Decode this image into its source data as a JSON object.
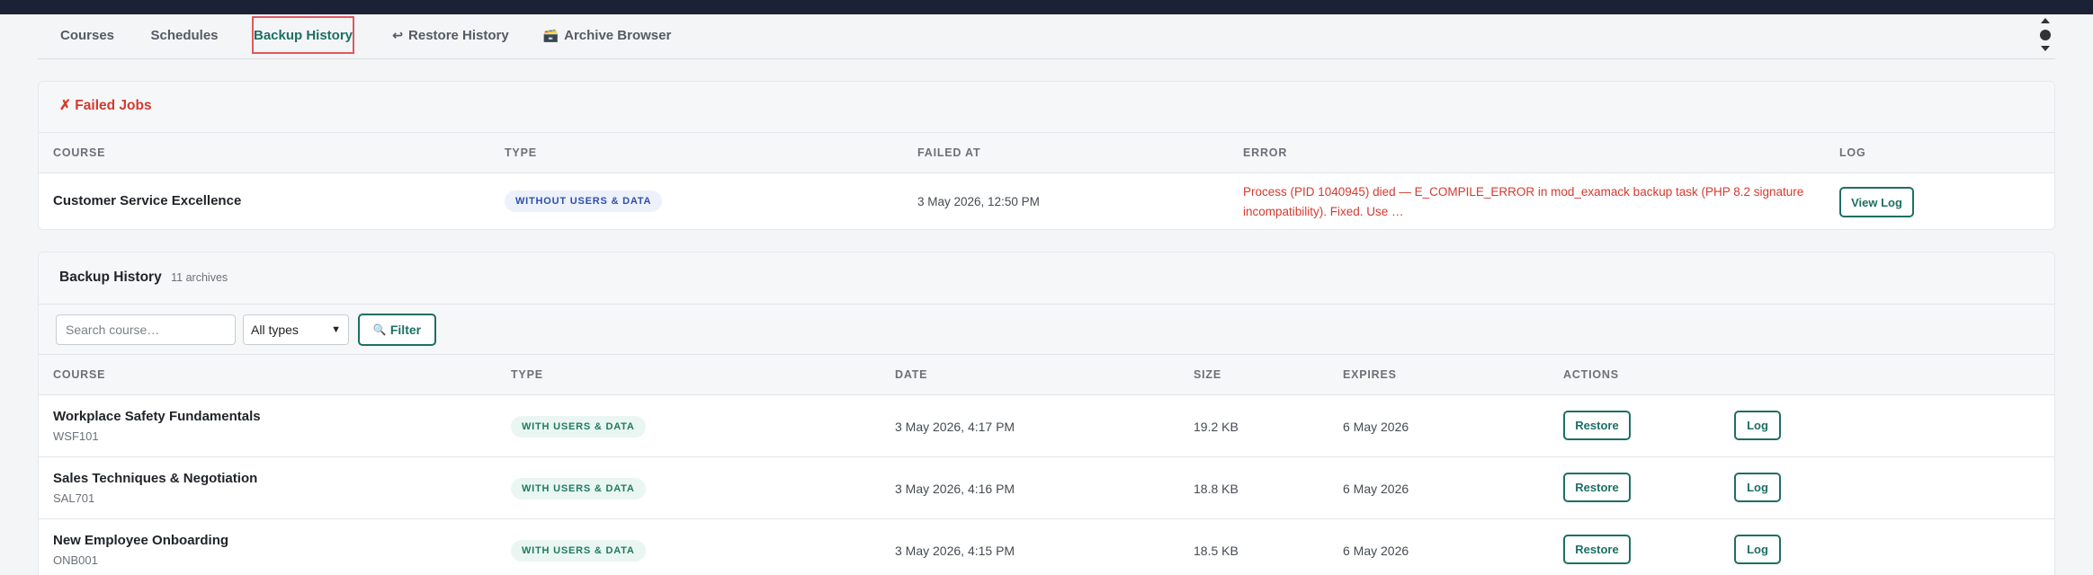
{
  "tabs": [
    {
      "label": "Courses",
      "icon": ""
    },
    {
      "label": "Schedules",
      "icon": ""
    },
    {
      "label": "Backup History",
      "icon": ""
    },
    {
      "label": "Restore History",
      "icon": "↩"
    },
    {
      "label": "Archive Browser",
      "icon": "🗃️"
    }
  ],
  "failed": {
    "title": "✗ Failed Jobs",
    "columns": [
      "Course",
      "Type",
      "Failed At",
      "Error",
      "Log"
    ],
    "rows": [
      {
        "course": "Customer Service Excellence",
        "type": "Without users & data",
        "failed_at": "3 May 2026, 12:50 PM",
        "error": "Process (PID 1040945) died — E_COMPILE_ERROR in mod_examack backup task (PHP 8.2 signature incompatibility). Fixed. Use …",
        "action": "View Log"
      }
    ]
  },
  "history": {
    "title": "Backup History",
    "count": "11 archives",
    "search_placeholder": "Search course…",
    "type_filter": "All types",
    "filter_button": "Filter",
    "filter_icon": "🔍",
    "columns": [
      "Course",
      "Type",
      "Date",
      "Size",
      "Expires",
      "Actions"
    ],
    "restore_label": "Restore",
    "log_label": "Log",
    "rows": [
      {
        "course": "Workplace Safety Fundamentals",
        "code": "WSF101",
        "type": "With users & data",
        "date": "3 May 2026, 4:17 PM",
        "size": "19.2 KB",
        "expires": "6 May 2026"
      },
      {
        "course": "Sales Techniques & Negotiation",
        "code": "SAL701",
        "type": "With users & data",
        "date": "3 May 2026, 4:16 PM",
        "size": "18.8 KB",
        "expires": "6 May 2026"
      },
      {
        "course": "New Employee Onboarding",
        "code": "ONB001",
        "type": "With users & data",
        "date": "3 May 2026, 4:15 PM",
        "size": "18.5 KB",
        "expires": "6 May 2026"
      }
    ]
  },
  "colors": {
    "accent": "#1d6f63",
    "error": "#d43a2f",
    "topbar": "#1b2235",
    "active_tab_outline": "#e0585e"
  }
}
